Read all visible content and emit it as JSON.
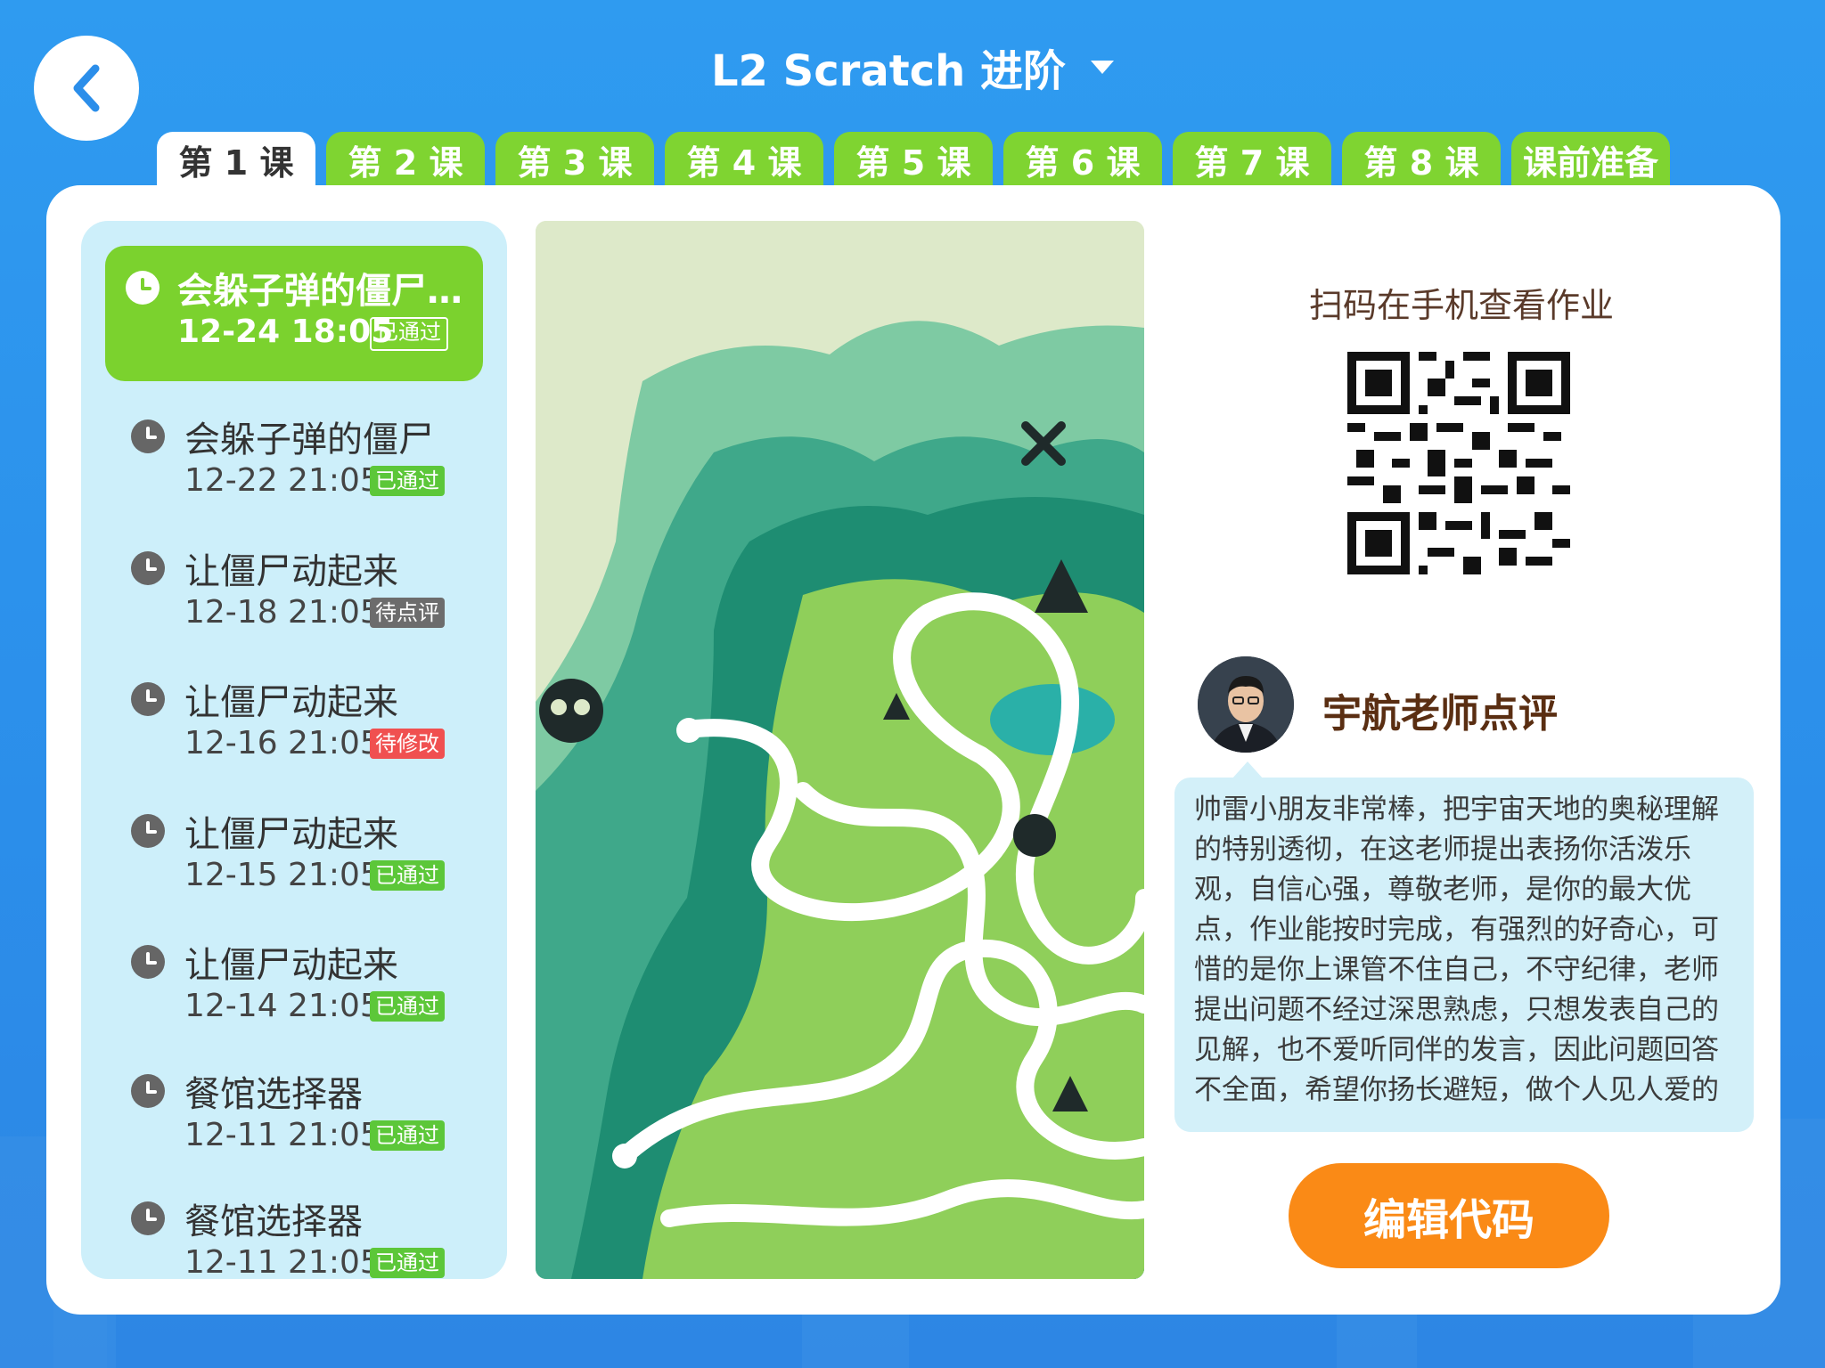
{
  "header": {
    "title": "L2 Scratch 进阶"
  },
  "tabs": [
    "第 1 课",
    "第 2 课",
    "第 3 课",
    "第 4 课",
    "第 5 课",
    "第 6 课",
    "第 7 课",
    "第 8 课",
    "课前准备"
  ],
  "submissions": [
    {
      "title": "会躲子弹的僵尸…",
      "date": "12-24 18:05",
      "status": "已通过",
      "type": "pass"
    },
    {
      "title": "会躲子弹的僵尸",
      "date": "12-22 21:05",
      "status": "已通过",
      "type": "pass"
    },
    {
      "title": "让僵尸动起来",
      "date": "12-18 21:05",
      "status": "待点评",
      "type": "review"
    },
    {
      "title": "让僵尸动起来",
      "date": "12-16 21:05",
      "status": "待修改",
      "type": "fix"
    },
    {
      "title": "让僵尸动起来",
      "date": "12-15 21:05",
      "status": "已通过",
      "type": "pass"
    },
    {
      "title": "让僵尸动起来",
      "date": "12-14 21:05",
      "status": "已通过",
      "type": "pass"
    },
    {
      "title": "餐馆选择器",
      "date": "12-11 21:05",
      "status": "已通过",
      "type": "pass"
    },
    {
      "title": "餐馆选择器",
      "date": "12-11 21:05",
      "status": "已通过",
      "type": "pass"
    }
  ],
  "qr": {
    "label": "扫码在手机查看作业"
  },
  "teacher": {
    "name": "宇航老师点评",
    "comment": "帅雷小朋友非常棒，把宇宙天地的奥秘理解的特别透彻，在这老师提出表扬你活泼乐观，自信心强，尊敬老师，是你的最大优点，作业能按时完成，有强烈的好奇心，可惜的是你上课管不住自己，不守纪律，老师提出问题不经过深思熟虑，只想发表自己的见解，也不爱听同伴的发言，因此问题回答不全面，希望你扬长避短，做个人见人爱的"
  },
  "actions": {
    "edit_code": "编辑代码"
  },
  "colors": {
    "accent_green": "#7bd22e",
    "orange": "#fa8a16",
    "background_blue": "#2f9bf0"
  }
}
